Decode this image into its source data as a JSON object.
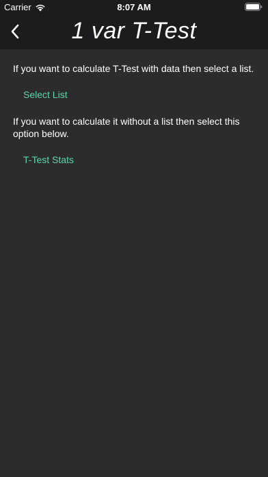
{
  "status_bar": {
    "carrier": "Carrier",
    "time": "8:07 AM",
    "icons": [
      "wifi-icon",
      "battery-icon"
    ]
  },
  "nav": {
    "title": "1 var T-Test",
    "back_icon": "chevron-left-icon"
  },
  "content": {
    "instruction_list": "If you want to calculate T-Test with data then select a list.",
    "select_list_label": "Select List",
    "instruction_no_list": "If you want to calculate it without a list then select this option below.",
    "stats_label": "T-Test Stats"
  },
  "colors": {
    "background": "#2c2c2e",
    "nav_background": "#1c1c1e",
    "text": "#ffffff",
    "accent": "#5ed6a7"
  }
}
